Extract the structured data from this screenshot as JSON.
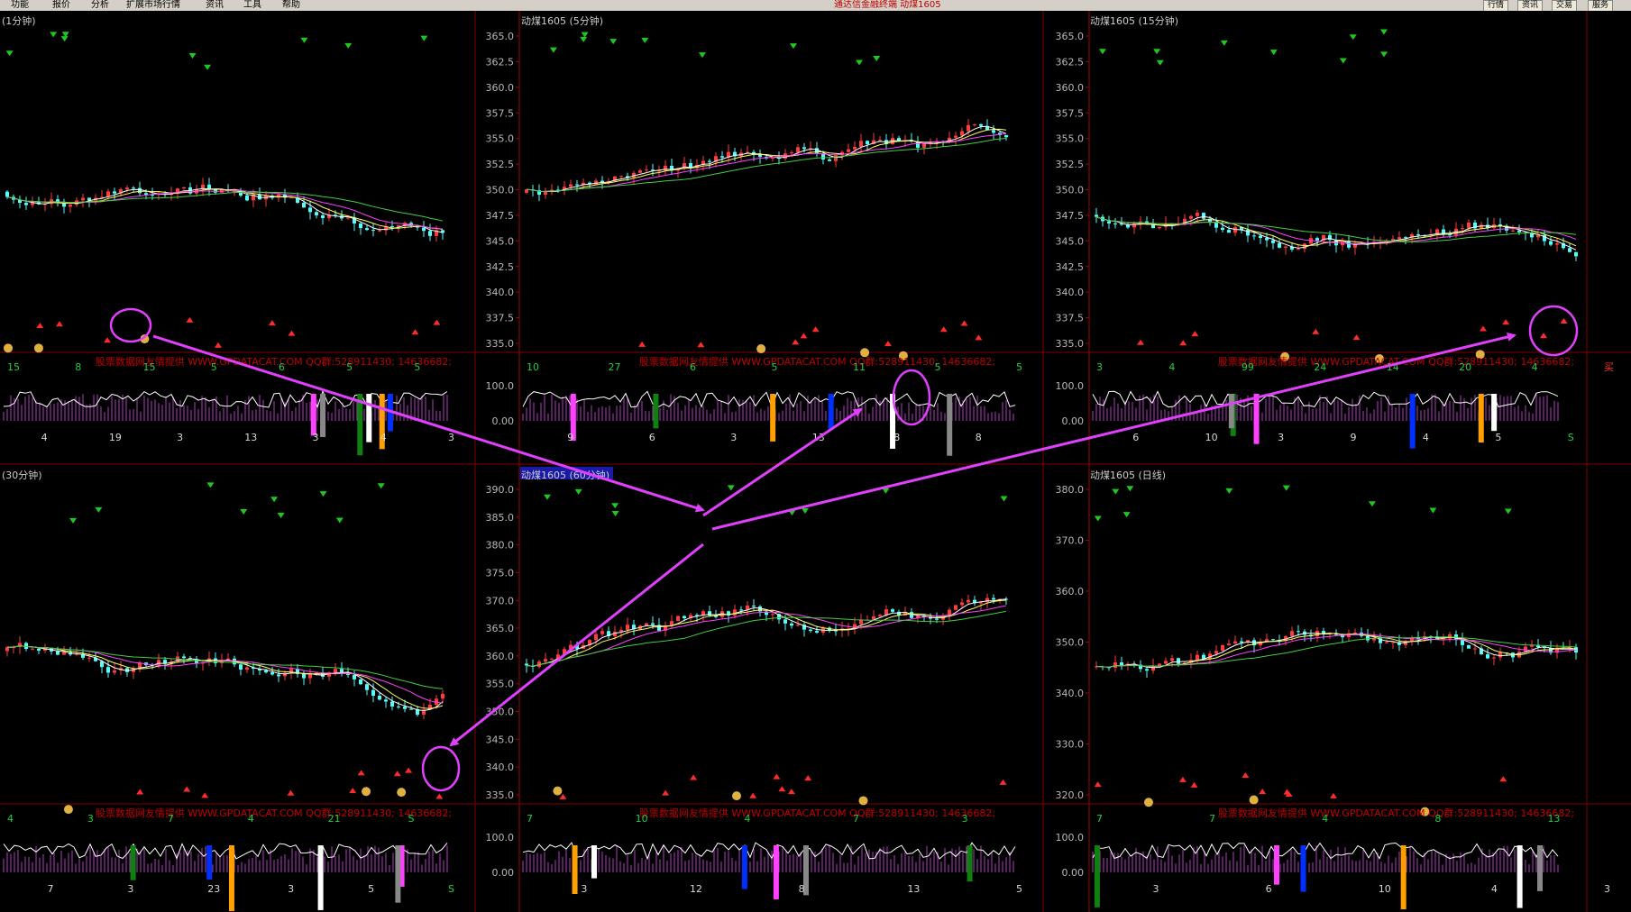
{
  "menu": {
    "items": [
      "功能",
      "报价",
      "分析",
      "扩展市场行情",
      "资讯",
      "工具",
      "帮助"
    ],
    "center": "通达信金融终端 动煤1605",
    "right": [
      "行情",
      "资讯",
      "交易",
      "服务"
    ]
  },
  "panels": [
    {
      "title": "(1分钟)"
    },
    {
      "title": "动煤1605 (5分钟)",
      "ticks": [
        "365.0",
        "362.5",
        "360.0",
        "357.5",
        "355.0",
        "352.5",
        "350.0",
        "347.5",
        "345.0",
        "342.5",
        "340.0",
        "337.5",
        "335.0"
      ]
    },
    {
      "title": "动煤1605 (15分钟)",
      "ticks": [
        "365.0",
        "362.5",
        "360.0",
        "357.5",
        "355.0",
        "352.5",
        "350.0",
        "347.5",
        "345.0",
        "342.5",
        "340.0",
        "337.5",
        "335.0"
      ]
    },
    {
      "title": "(30分钟)"
    },
    {
      "title": "动煤1605 (60分钟)",
      "ticks": [
        "390.0",
        "385.0",
        "380.0",
        "375.0",
        "370.0",
        "365.0",
        "360.0",
        "355.0",
        "350.0",
        "345.0",
        "340.0",
        "335.0"
      ]
    },
    {
      "title": "动煤1605 (日线)",
      "ticks": [
        "380.0",
        "370.0",
        "360.0",
        "350.0",
        "340.0",
        "330.0",
        "320.0"
      ]
    }
  ],
  "watermark": "股票数据网友情提供 WWW.GPDATACAT.COM QQ群:528911430; 14636682;",
  "ind_ticks": [
    "100.0",
    "0.00"
  ],
  "ind_labels": [
    [
      "15",
      "4",
      "8",
      "19",
      "15",
      "3",
      "5",
      "13",
      "6",
      "3",
      "5",
      "4",
      "5",
      "3"
    ],
    [
      "10",
      "9",
      "27",
      "6",
      "6",
      "3",
      "5",
      "13",
      "11",
      "8",
      "5",
      "8",
      "5"
    ],
    [
      "3",
      "6",
      "4",
      "10",
      "99",
      "3",
      "24",
      "9",
      "14",
      "4",
      "20",
      "5",
      "4",
      "S",
      "买"
    ],
    [
      "4",
      "7",
      "3",
      "3",
      "7",
      "23",
      "4",
      "3",
      "21",
      "5",
      "S",
      "S"
    ],
    [
      "7",
      "3",
      "10",
      "12",
      "4",
      "8",
      "7",
      "13",
      "3",
      "5"
    ],
    [
      "7",
      "3",
      "7",
      "6",
      "4",
      "10",
      "8",
      "4",
      "13",
      "3"
    ]
  ],
  "colors": {
    "up": "#ff3c3c",
    "down": "#54fcfc",
    "grid": "#800000",
    "axis": "#a00000",
    "arrow": "#e040fb",
    "ma1": "#ffffff",
    "ma2": "#ffff60",
    "ma3": "#ff40ff",
    "ma4": "#40d040"
  }
}
